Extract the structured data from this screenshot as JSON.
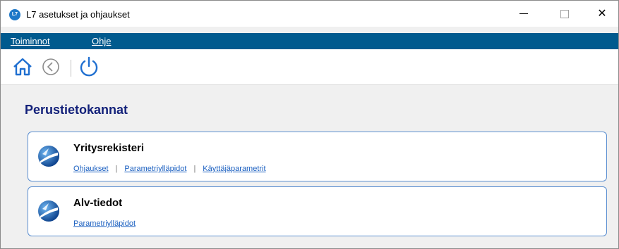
{
  "window": {
    "title": "L7 asetukset ja ohjaukset",
    "app_icon_text": "L7",
    "minimize_glyph": "",
    "maximize_glyph": "",
    "close_glyph": "✕"
  },
  "menu": {
    "items": [
      {
        "label": "Toiminnot"
      },
      {
        "label": "Ohje"
      }
    ]
  },
  "toolbar": {
    "icons": [
      "home-icon",
      "back-icon",
      "power-icon"
    ],
    "accent_color": "#1f6fd0"
  },
  "main": {
    "section_title": "Perustietokannat",
    "cards": [
      {
        "title": "Yritysrekisteri",
        "links": [
          "Ohjaukset",
          "Parametriylläpidot",
          "Käyttäjäparametrit"
        ]
      },
      {
        "title": "Alv-tiedot",
        "links": [
          "Parametriylläpidot"
        ]
      }
    ]
  },
  "colors": {
    "menubar_bg": "#005a8e",
    "section_title": "#13217a",
    "card_border": "#5a8ed0",
    "link": "#1a5fc0"
  }
}
